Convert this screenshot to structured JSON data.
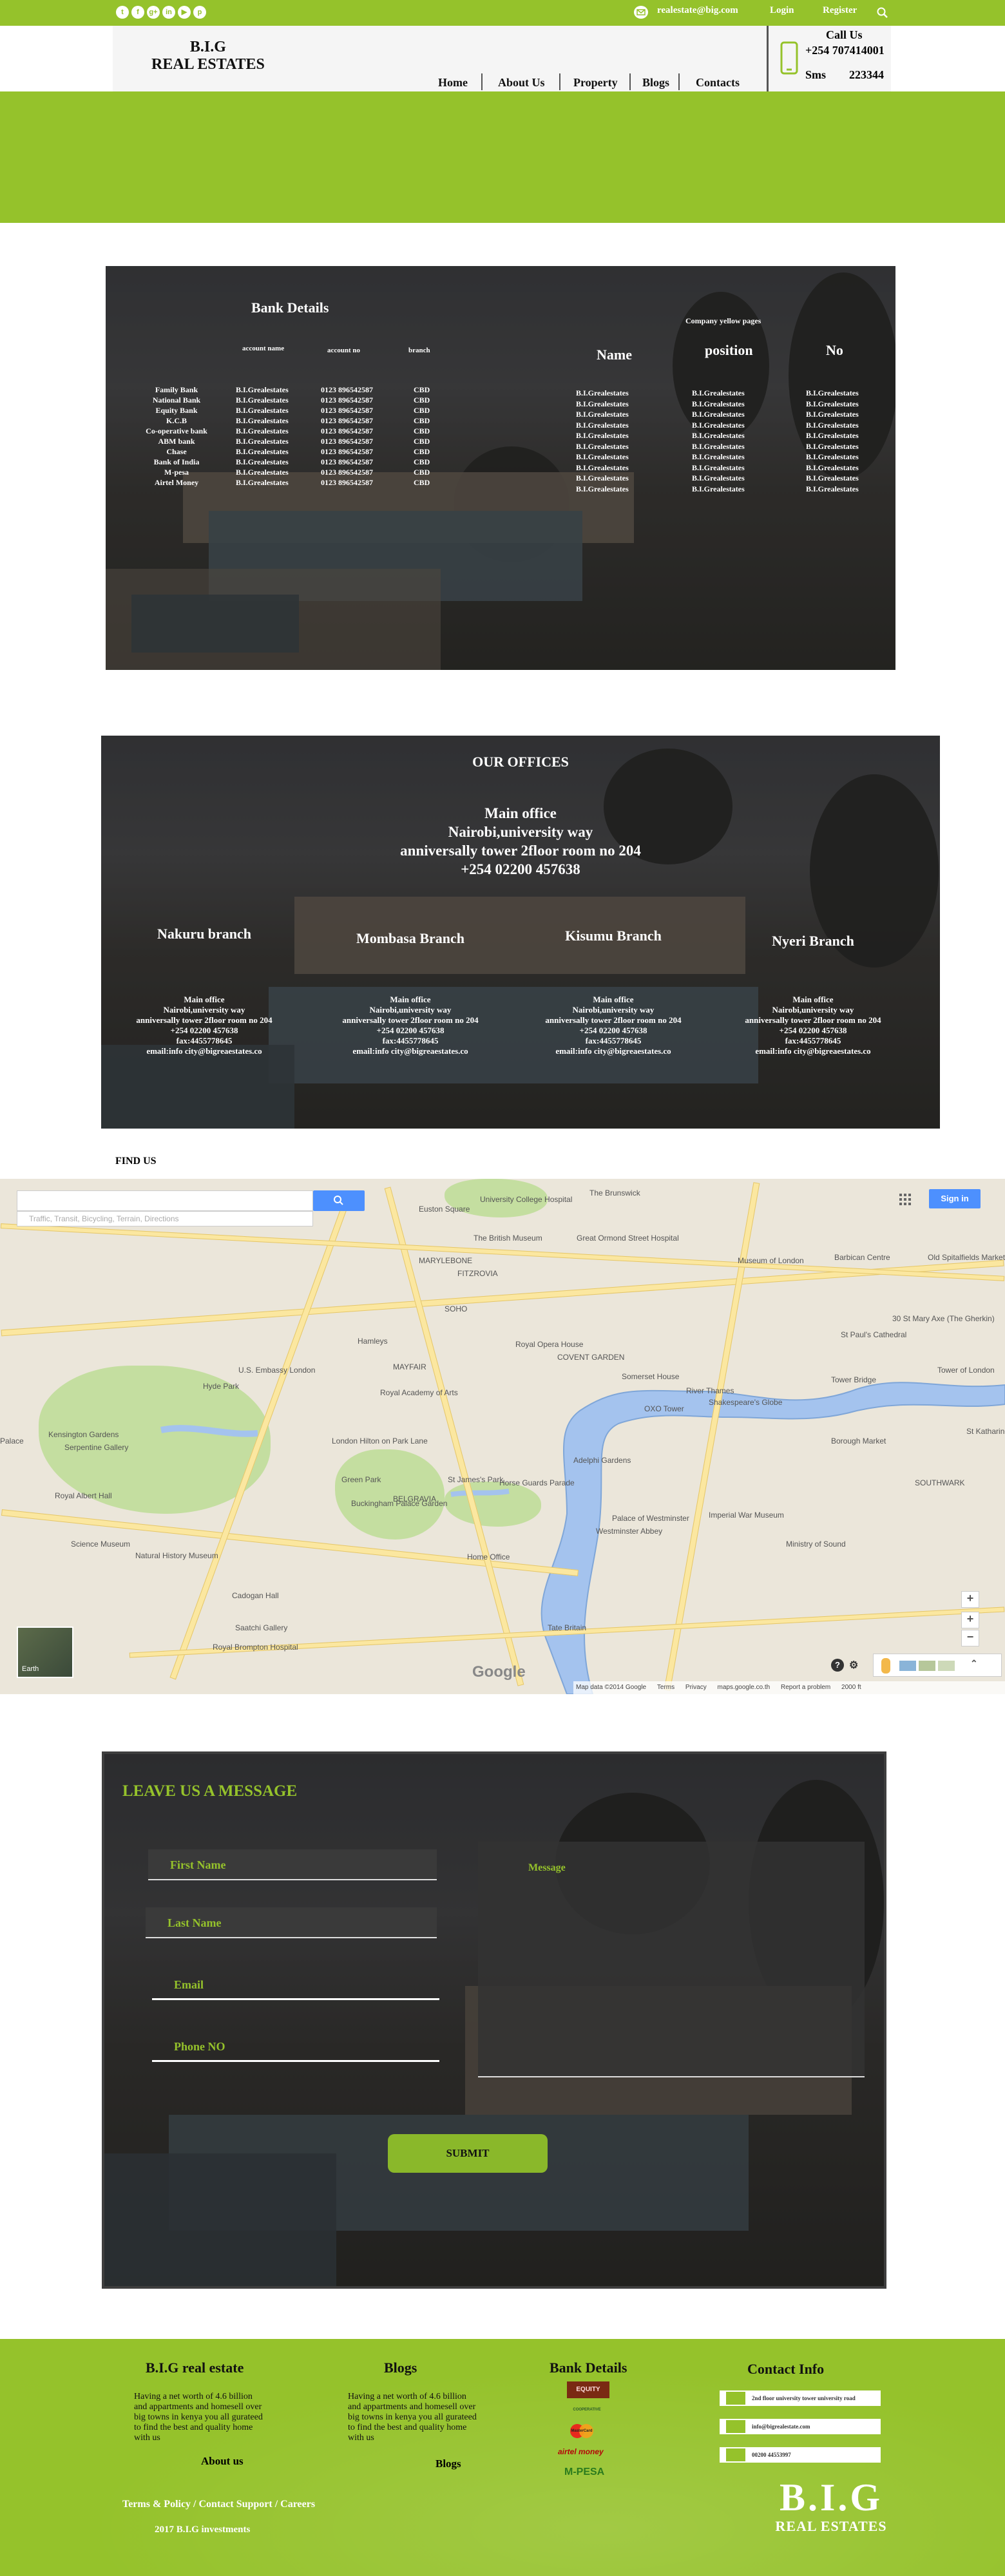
{
  "topbar": {
    "social": [
      {
        "icon": "twitter-icon",
        "glyph": "t"
      },
      {
        "icon": "facebook-icon",
        "glyph": "f"
      },
      {
        "icon": "google-plus-icon",
        "glyph": "g+"
      },
      {
        "icon": "linkedin-icon",
        "glyph": "in"
      },
      {
        "icon": "youtube-icon",
        "glyph": "▶"
      },
      {
        "icon": "pinterest-icon",
        "glyph": "p"
      }
    ],
    "email": "realestate@big.com",
    "login": "Login",
    "register": "Register",
    "search_icon": "search-icon"
  },
  "header": {
    "logo_line1": "B.I.G",
    "logo_line2": "REAL ESTATES",
    "nav": [
      "Home",
      "About Us",
      "Property",
      "Blogs",
      "Contacts"
    ],
    "call_label": "Call Us",
    "phone": "+254 707414001",
    "sms_label": "Sms",
    "sms_number": "223344",
    "phone_icon": "mobile-phone-icon"
  },
  "bank": {
    "title": "Bank Details",
    "headers": [
      "account name",
      "account no",
      "branch"
    ],
    "banks": [
      "Family Bank",
      "National Bank",
      "Equity Bank",
      "K.C.B",
      "Co-operative bank",
      "ABM bank",
      "Chase",
      "Bank of India",
      "M-pesa",
      "Airtel Money"
    ],
    "account_name": "B.I.Grealestates",
    "account_no": "0123 896542587",
    "branch": "CBD",
    "yellow_title": "Company yellow pages",
    "yellow_headers": [
      "Name",
      "position",
      "No"
    ],
    "yellow_value": "B.I.Grealestates"
  },
  "offices": {
    "title": "OUR  OFFICES",
    "main": [
      "Main office",
      "Nairobi,university way",
      "anniversally tower 2floor room no 204",
      "+254 02200 457638"
    ],
    "branches": [
      {
        "name": "Nakuru branch",
        "lines": [
          "Main office",
          "Nairobi,university way",
          "anniversally tower 2floor room no 204",
          "+254 02200 457638",
          "fax:4455778645",
          "email:info city@bigreaestates.co"
        ]
      },
      {
        "name": "Mombasa Branch",
        "lines": [
          "Main office",
          "Nairobi,university way",
          "anniversally tower 2floor room no 204",
          "+254 02200 457638",
          "fax:4455778645",
          "email:info city@bigreaestates.co"
        ]
      },
      {
        "name": "Kisumu Branch",
        "lines": [
          "Main office",
          "Nairobi,university way",
          "anniversally tower 2floor room no 204",
          "+254 02200 457638",
          "fax:4455778645",
          "email:info city@bigreaestates.co"
        ]
      },
      {
        "name": "Nyeri Branch",
        "lines": [
          "Main office",
          "Nairobi,university way",
          "anniversally tower 2floor room no 204",
          "+254 02200 457638",
          "fax:4455778645",
          "email:info city@bigreaestates.co"
        ]
      }
    ]
  },
  "map": {
    "find_us": "FIND US",
    "search_placeholder": "Traffic, Transit, Bicycling, Terrain, Directions",
    "sign_in": "Sign in",
    "earth": "Earth",
    "google": "Google",
    "footer_links": [
      "Map data ©2014 Google",
      "Terms",
      "Privacy",
      "maps.google.co.th",
      "Report a problem",
      "2000 ft"
    ],
    "labels": [
      "University College Hospital",
      "The Brunswick",
      "Euston Square",
      "The British Museum",
      "Great Ormond Street Hospital",
      "Museum of London",
      "Barbican Centre",
      "Old Spitalfields Market",
      "30 St Mary Axe (The Gherkin)",
      "St Paul's Cathedral",
      "Tower of London",
      "Tower Bridge",
      "Hamleys",
      "Royal Opera House",
      "COVENT GARDEN",
      "Somerset House",
      "U.S. Embassy London",
      "Royal Academy of Arts",
      "Hyde Park",
      "Kensington Gardens",
      "Serpentine Gallery",
      "London Hilton on Park Lane",
      "Green Park",
      "Buckingham Palace Garden",
      "St James's Park",
      "Horse Guards Parade",
      "Palace of Westminster",
      "Royal Albert Hall",
      "Science Museum",
      "Natural History Museum",
      "Cadogan Hall",
      "Saatchi Gallery",
      "Royal Brompton Hospital",
      "Tate Britain",
      "Home Office",
      "Borough Market",
      "Ministry of Sound",
      "SOUTHWARK",
      "MAYFAIR",
      "SOHO",
      "BELGRAVIA",
      "MARYLEBONE",
      "FITZROVIA",
      "Shakespeare's Globe",
      "OXO Tower",
      "River Thames",
      "Imperial War Museum",
      "Adelphi Gardens",
      "Westminster Abbey",
      "Palace",
      "St Katharine"
    ]
  },
  "message": {
    "title": "LEAVE US A MESSAGE",
    "first_name": "First Name",
    "last_name": "Last Name",
    "email": "Email",
    "phone": "Phone NO",
    "message": "Message",
    "submit": "SUBMIT"
  },
  "footer": {
    "col1_title": "B.I.G real estate",
    "col1_text": "Having a net worth of 4.6 billion and appartments and homesell over big towns in kenya you all gurateed to find the best and quality home with us",
    "col1_link": "About us",
    "col2_title": "Blogs",
    "col2_text": "Having a net worth of 4.6 billion and appartments and homesell over big towns in kenya you all gurateed to find the best and quality home with us",
    "col2_link": "Blogs",
    "col3_title": "Bank Details",
    "bank_logos": [
      "EQUITY",
      "COOPERATIVE",
      "MasterCard",
      "airtel money",
      "M-PESA"
    ],
    "col4_title": "Contact Info",
    "contact": [
      "2nd floor university tower university road",
      "info@bigrealestate.com",
      "00200 44553997"
    ],
    "terms": "Terms & Policy / Contact Support / Careers",
    "copyright": "2017 B.I.G investments",
    "logo1": "B.I.G",
    "logo2": "REAL ESTATES"
  },
  "colors": {
    "accent": "#95c22b",
    "dark": "#3a3a3a"
  }
}
